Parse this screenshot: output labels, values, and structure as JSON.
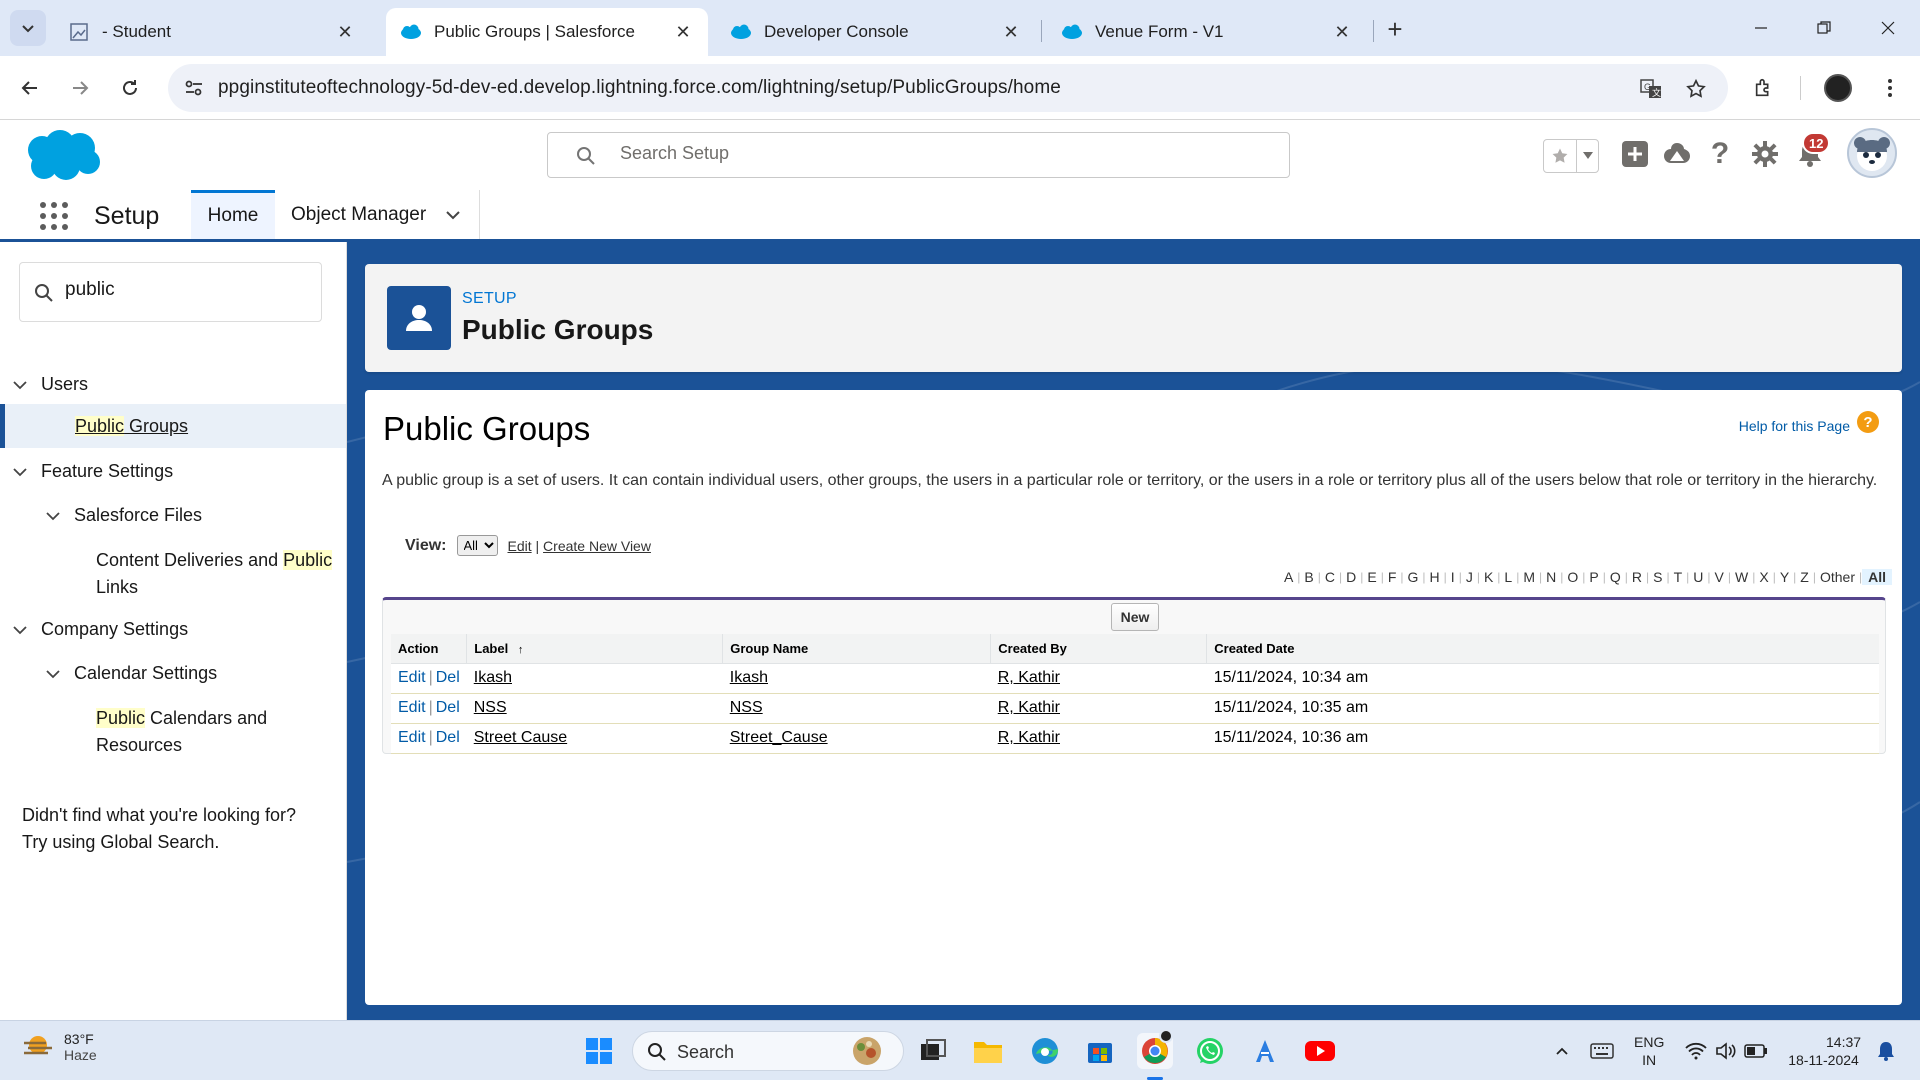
{
  "browser": {
    "tabs": [
      {
        "title": "- Student",
        "active": false
      },
      {
        "title": "Public Groups | Salesforce",
        "active": true
      },
      {
        "title": "Developer Console",
        "active": false
      },
      {
        "title": "Venue Form - V1",
        "active": false
      }
    ],
    "url": "ppginstituteoftechnology-5d-dev-ed.develop.lightning.force.com/lightning/setup/PublicGroups/home"
  },
  "sf_header": {
    "search_placeholder": "Search Setup",
    "notification_count": "12"
  },
  "setup_nav": {
    "app_name": "Setup",
    "tabs": [
      {
        "label": "Home",
        "active": true
      },
      {
        "label": "Object Manager",
        "active": false
      }
    ]
  },
  "sidebar": {
    "quick_find_value": "public",
    "tree": {
      "users": "Users",
      "public_groups_hl": "Public",
      "public_groups_rest": " Groups",
      "feature_settings": "Feature Settings",
      "salesforce_files": "Salesforce Files",
      "content_deliveries_pre": "Content Deliveries and ",
      "content_deliveries_hl": "Public",
      "content_deliveries_post": "Links",
      "company_settings": "Company Settings",
      "calendar_settings": "Calendar Settings",
      "public_calendars_hl": "Public",
      "public_calendars_rest": " Calendars and",
      "public_calendars_post": "Resources"
    },
    "not_found_line1": "Didn't find what you're looking for?",
    "not_found_line2": "Try using Global Search."
  },
  "page_header": {
    "breadcrumb": "SETUP",
    "title": "Public Groups"
  },
  "content": {
    "title": "Public Groups",
    "help_link": "Help for this Page",
    "description": "A public group is a set of users. It can contain individual users, other groups, the users in a particular role or territory, or the users in a role or territory plus all of the users below that role or territory in the hierarchy.",
    "view_label": "View:",
    "view_selected": "All",
    "edit_link": "Edit",
    "create_view_link": "Create New View",
    "alphabet": [
      "A",
      "B",
      "C",
      "D",
      "E",
      "F",
      "G",
      "H",
      "I",
      "J",
      "K",
      "L",
      "M",
      "N",
      "O",
      "P",
      "Q",
      "R",
      "S",
      "T",
      "U",
      "V",
      "W",
      "X",
      "Y",
      "Z",
      "Other",
      "All"
    ],
    "new_button": "New",
    "columns": [
      "Action",
      "Label",
      "Group Name",
      "Created By",
      "Created Date"
    ],
    "sort_indicator": "↑",
    "action_edit": "Edit",
    "action_del": "Del",
    "rows": [
      {
        "label": "Ikash",
        "group_name": "Ikash",
        "created_by": "R, Kathir",
        "created_date": "15/11/2024, 10:34 am"
      },
      {
        "label": "NSS",
        "group_name": "NSS",
        "created_by": "R, Kathir",
        "created_date": "15/11/2024, 10:35 am"
      },
      {
        "label": "Street Cause",
        "group_name": "Street_Cause",
        "created_by": "R, Kathir",
        "created_date": "15/11/2024, 10:36 am"
      }
    ]
  },
  "taskbar": {
    "temperature": "83°F",
    "condition": "Haze",
    "search_label": "Search",
    "language": "ENG",
    "region": "IN",
    "time": "14:37",
    "date": "18-11-2024"
  },
  "colors": {
    "salesforce_blue": "#1b5297",
    "brand_cloud": "#00a1e0",
    "link_blue": "#0176d3",
    "notification_red": "#c23934",
    "highlight_yellow": "#fffec9"
  }
}
